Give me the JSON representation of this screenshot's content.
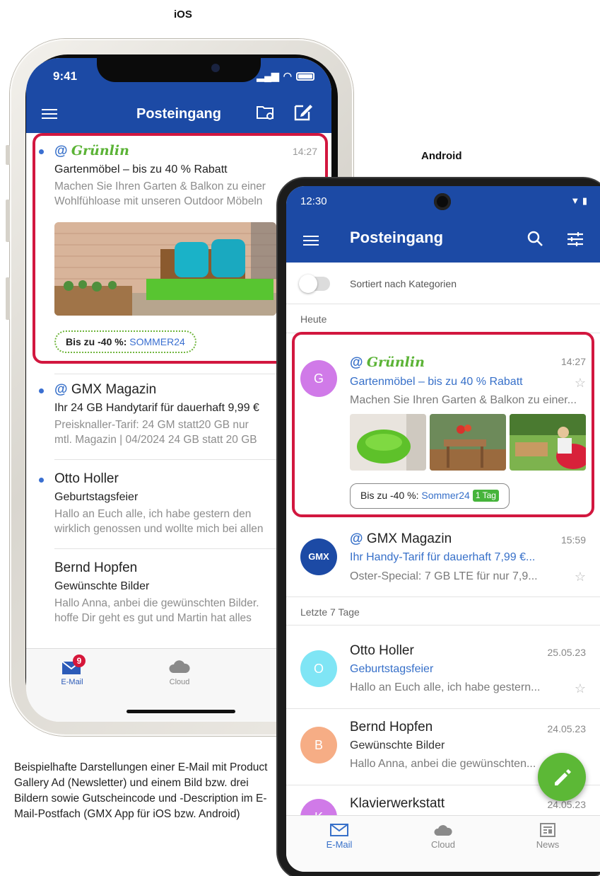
{
  "labels": {
    "ios": "iOS",
    "android": "Android"
  },
  "caption": "Beispielhafte Darstellungen einer E-Mail mit Product Gallery Ad (Newsletter) und einem Bild bzw. drei Bildern sowie Gutscheincode und -Description im E-Mail-Postfach (GMX App für iOS bzw. Android)",
  "colors": {
    "header_blue": "#1c4aa5",
    "highlight_red": "#d2173f",
    "brand_green": "#5bb336",
    "link_blue": "#3770c9",
    "fab_green": "#5cb836"
  },
  "ios": {
    "status_time": "9:41",
    "title": "Posteingang",
    "icons": [
      "menu-icon",
      "folder-settings-icon",
      "compose-icon"
    ],
    "ad": {
      "sender": "Grünlin",
      "time": "14:27",
      "subject": "Gartenmöbel – bis zu 40 % Rabatt",
      "preview_1": "Machen Sie Ihren Garten & Balkon zu einer",
      "preview_2": "Wohlfühloase mit unseren Outdoor Möbeln",
      "coupon_label": "Bis zu -40 %:",
      "coupon_code": "SOMMER24"
    },
    "mails": [
      {
        "sender": "GMX Magazin",
        "subject": "Ihr 24 GB Handytarif für dauerhaft 9,99 €",
        "preview_1": "Preisknaller-Tarif: 24 GM statt20 GB nur",
        "preview_2": "mtl. Magazin | 04/2024 24 GB statt 20 GB"
      },
      {
        "sender": "Otto Holler",
        "subject": "Geburtstagsfeier",
        "preview_1": "Hallo an Euch alle, ich habe gestern den",
        "preview_2": "wirklich genossen und wollte mich bei allen"
      },
      {
        "sender": "Bernd Hopfen",
        "subject": "Gewünschte Bilder",
        "preview_1": "Hallo Anna, anbei die gewünschten Bilder.",
        "preview_2": "hoffe Dir geht es gut und Martin hat alles"
      }
    ],
    "tabs": {
      "email": "E-Mail",
      "cloud": "Cloud",
      "badge": "9"
    }
  },
  "android": {
    "status_time": "12:30",
    "title": "Posteingang",
    "sort_toggle_label": "Sortiert nach Kategorien",
    "section_today": "Heute",
    "section_week": "Letzte 7 Tage",
    "ad": {
      "avatar": "G",
      "sender": "Grünlin",
      "time": "14:27",
      "subject": "Gartenmöbel – bis zu 40 % Rabatt",
      "preview": "Machen Sie Ihren Garten & Balkon zu einer...",
      "coupon_label": "Bis zu -40 %:",
      "coupon_code": "Sommer24",
      "coupon_tag": "1 Tag"
    },
    "gmx": {
      "avatar": "GMX",
      "sender": "GMX Magazin",
      "time": "15:59",
      "subject": "Ihr Handy-Tarif für dauerhaft 7,99 €...",
      "preview": "Oster-Special: 7 GB LTE für nur 7,9..."
    },
    "otto": {
      "avatar": "O",
      "sender": "Otto Holler",
      "date": "25.05.23",
      "subject": "Geburtstagsfeier",
      "preview": "Hallo an Euch alle, ich habe gestern..."
    },
    "bernd": {
      "avatar": "B",
      "sender": "Bernd Hopfen",
      "date": "24.05.23",
      "subject": "Gewünschte Bilder",
      "preview": "Hallo Anna, anbei die gewünschten..."
    },
    "klavier": {
      "avatar": "K",
      "sender": "Klavierwerkstatt",
      "date": "24.05.23"
    },
    "tabs": {
      "email": "E-Mail",
      "cloud": "Cloud",
      "news": "News"
    }
  }
}
